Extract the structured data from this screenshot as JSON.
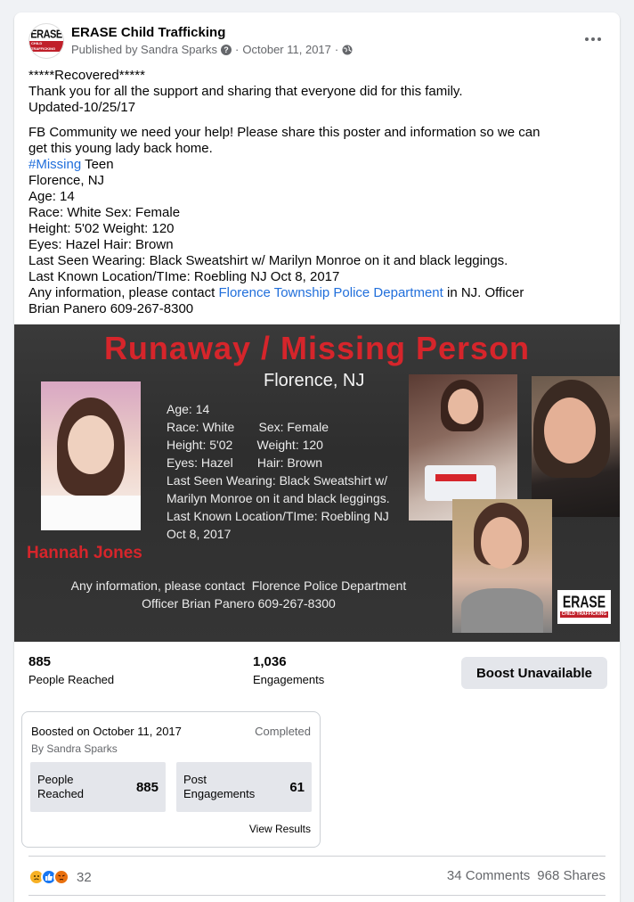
{
  "post": {
    "page_name": "ERASE Child Trafficking",
    "published_by": "Published by Sandra Sparks",
    "date": "October 11, 2017",
    "separator": "·",
    "avatar_logo": "ERASE",
    "avatar_logo_sub": "CHILD TRAFFICKING",
    "text": {
      "l1": "*****Recovered*****",
      "l2": "Thank you for all the support and sharing that everyone did for this family.",
      "l3": "Updated-10/25/17",
      "l4": "FB Community we need your help! Please share this poster and information so we can",
      "l5": "get this young lady back home.",
      "hashtag": "#Missing",
      "l6_rest": " Teen",
      "l7": "Florence, NJ",
      "l8": "Age: 14",
      "l9": "Race: White Sex: Female",
      "l10": "Height: 5'02 Weight: 120",
      "l11": "Eyes: Hazel Hair: Brown",
      "l12": "Last Seen Wearing: Black Sweatshirt w/ Marilyn Monroe on it and black leggings.",
      "l13": "Last Known Location/TIme: Roebling NJ Oct 8, 2017",
      "l14_pre": "Any information, please contact ",
      "l14_link": "Florence Township Police Department",
      "l14_post": " in NJ. Officer",
      "l15": "Brian Panero 609-267-8300"
    }
  },
  "poster": {
    "title": "Runaway / Missing Person",
    "subtitle": "Florence, NJ",
    "info": [
      "Age: 14",
      "Race: White       Sex: Female",
      "Height: 5'02       Weight: 120",
      "Eyes: Hazel       Hair: Brown",
      "Last Seen Wearing: Black Sweatshirt w/",
      "Marilyn Monroe on it and black leggings.",
      "Last Known Location/TIme: Roebling NJ",
      "Oct 8, 2017"
    ],
    "name": "Hannah Jones",
    "contact_1": "Any information, please contact  Florence Police Department",
    "contact_2": "Officer Brian Panero 609-267-8300",
    "logo": "ERASE",
    "logo_sub": "CHILD TRAFFICKING"
  },
  "stats": {
    "reached_value": "885",
    "reached_label": "People Reached",
    "engagements_value": "1,036",
    "engagements_label": "Engagements",
    "boost_button": "Boost Unavailable"
  },
  "boost_card": {
    "title": "Boosted on October 11, 2017",
    "status": "Completed",
    "by": "By Sandra Sparks",
    "metric1_label_1": "People",
    "metric1_label_2": "Reached",
    "metric1_value": "885",
    "metric2_label_1": "Post",
    "metric2_label_2": "Engagements",
    "metric2_value": "61",
    "view_results": "View Results"
  },
  "footer": {
    "reaction_count": "32",
    "comments": "34 Comments",
    "shares": "968 Shares",
    "reaction_icons": [
      "sad-reaction-icon",
      "like-reaction-icon",
      "angry-reaction-icon"
    ]
  },
  "colors": {
    "link": "#216fdb",
    "poster_red": "#d6252b",
    "muted": "#65676b"
  }
}
